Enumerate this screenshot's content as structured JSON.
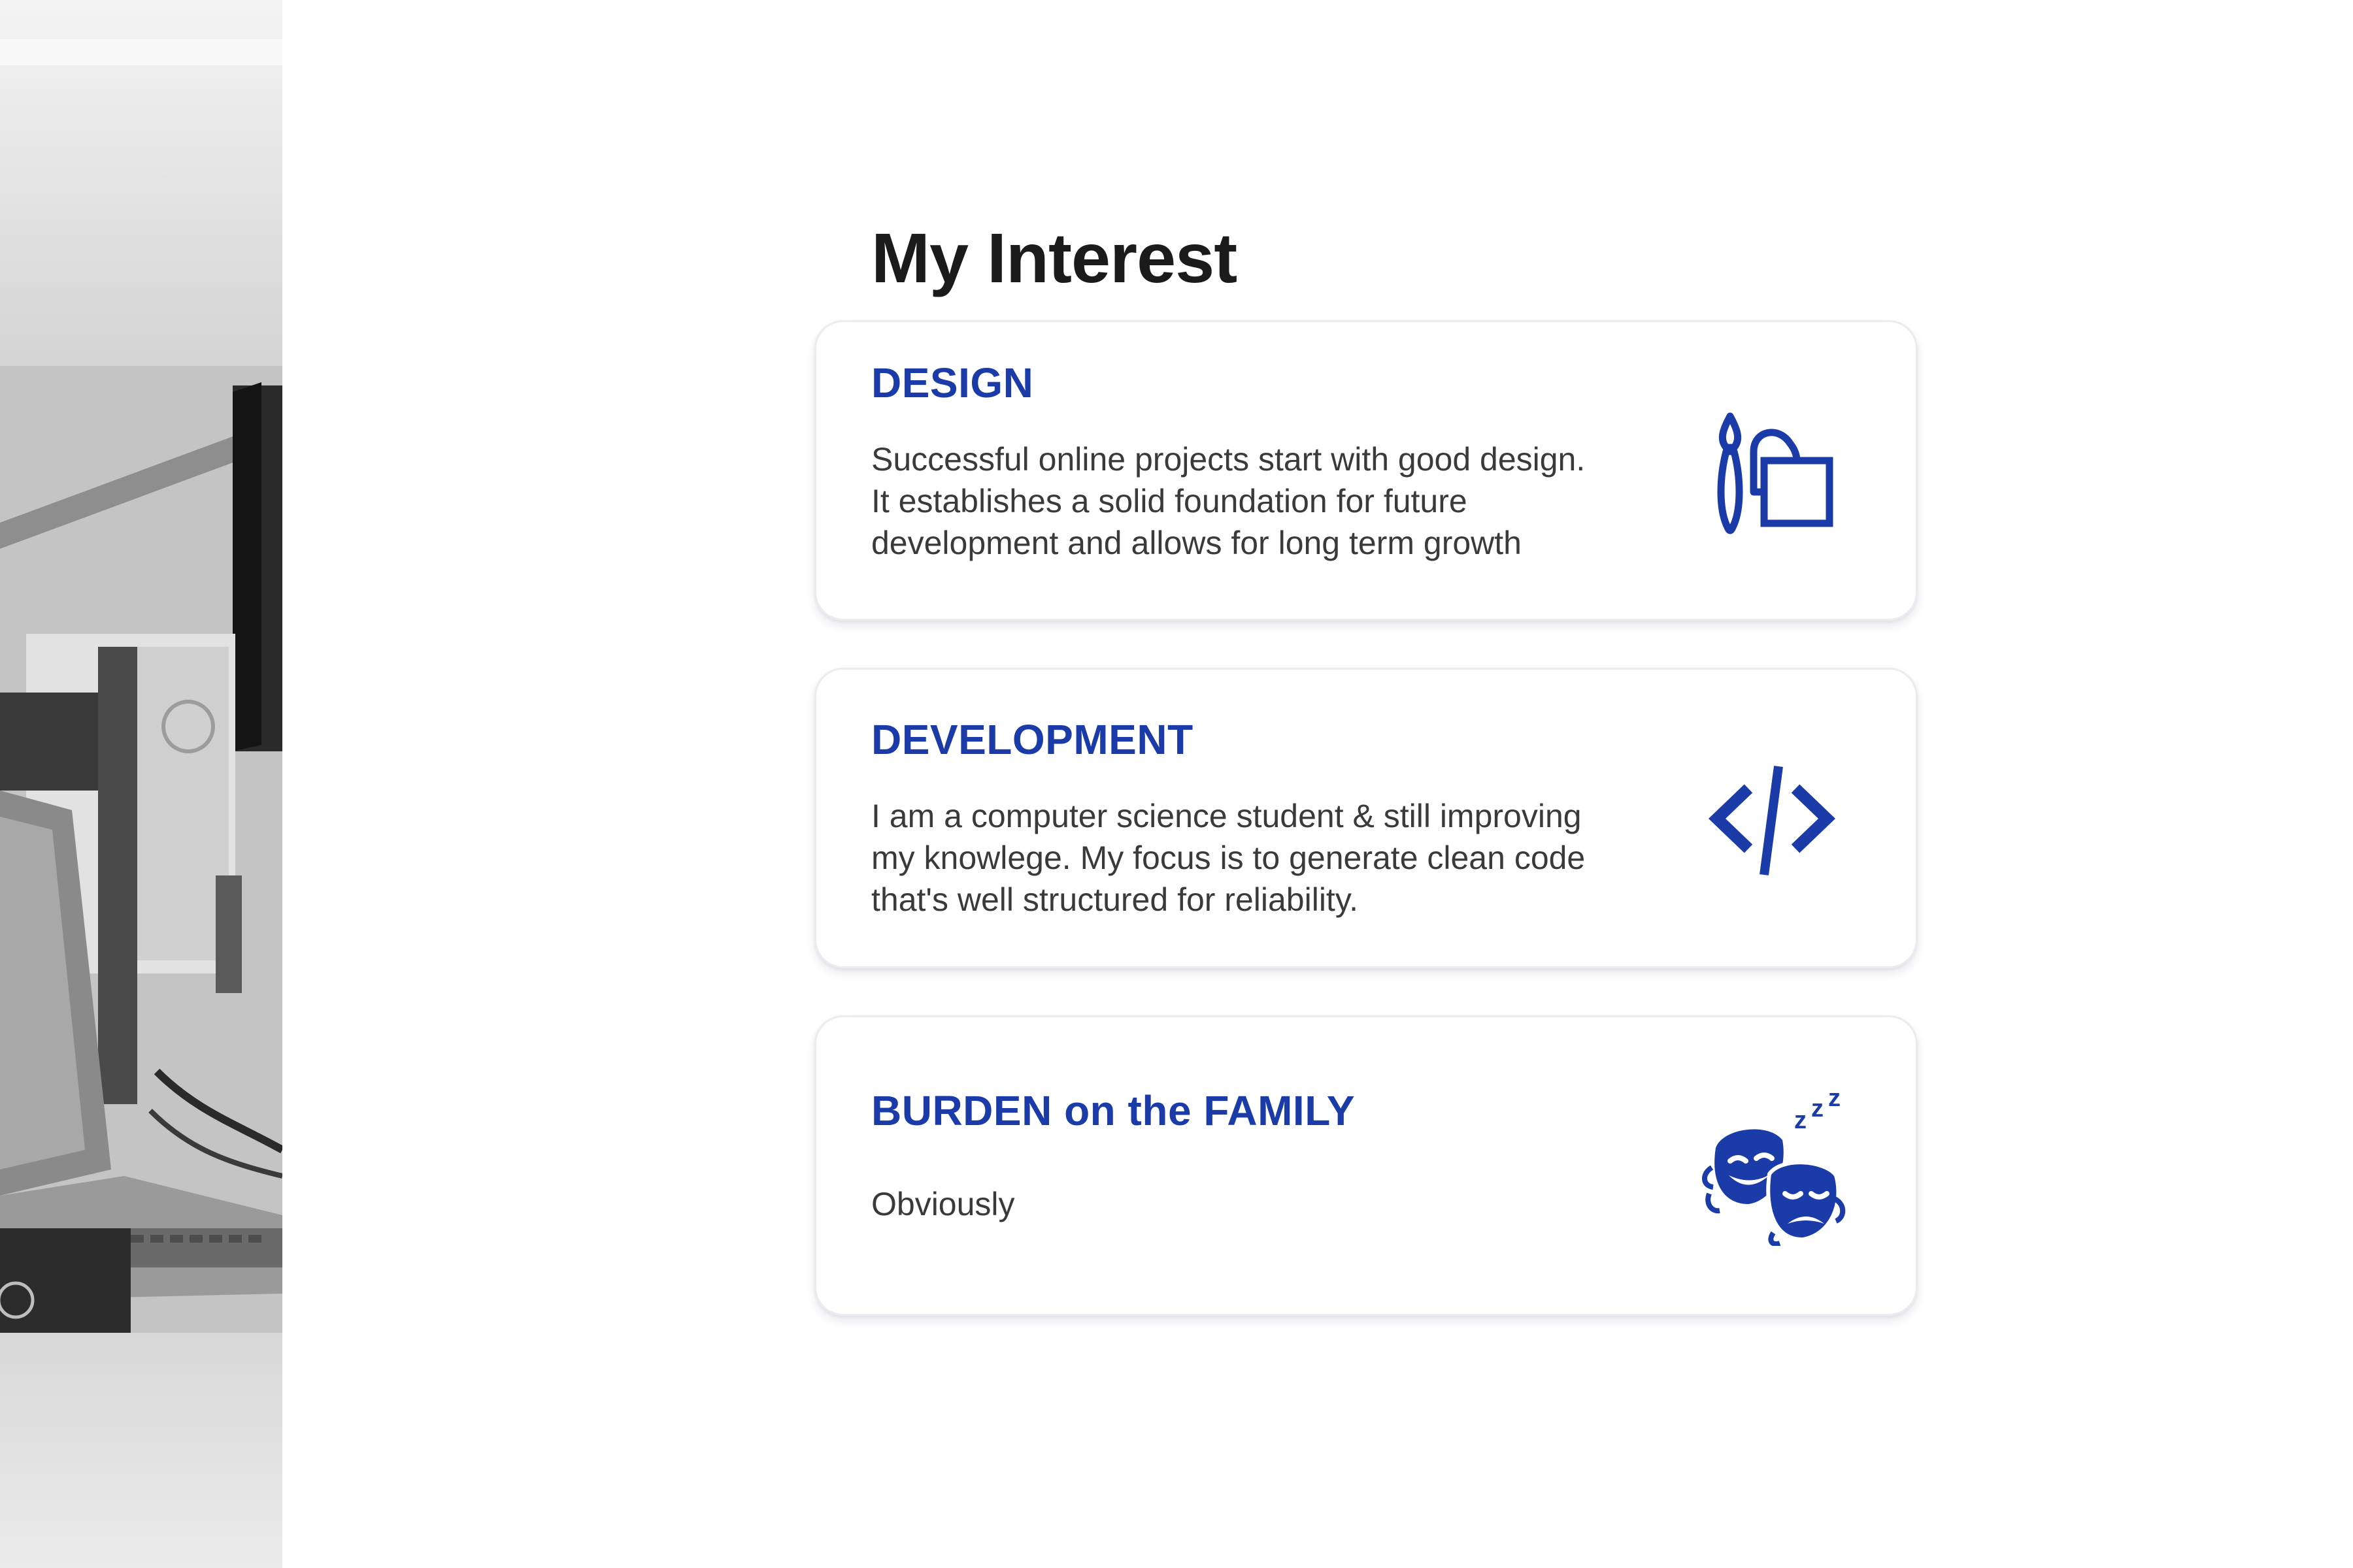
{
  "section": {
    "title": "My Interest"
  },
  "cards": [
    {
      "title": "DESIGN",
      "text": "Successful online projects start with good design.\nIt establishes a solid foundation for future\ndevelopment and allows for long term growth",
      "icon": "paintbrush-and-square-icon"
    },
    {
      "title": "DEVELOPMENT",
      "text": "I am a computer science student & still improving\nmy knowlege. My focus is to generate clean code\nthat's well structured for reliability.",
      "icon": "code-brackets-icon"
    },
    {
      "title": "BURDEN on the FAMILY",
      "text": "Obviously",
      "icon": "sleeping-theater-masks-icon"
    }
  ],
  "colors": {
    "accent": "#1a3ba8",
    "heading": "#1b1b1b",
    "body_text": "#3a3a3a",
    "card_border": "#ececf0"
  }
}
